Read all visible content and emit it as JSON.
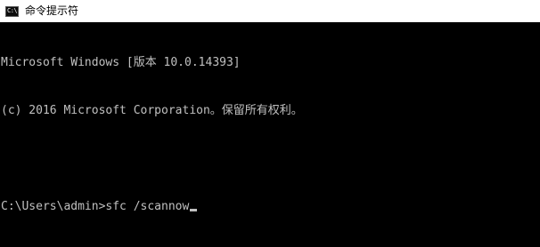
{
  "window": {
    "title": "命令提示符",
    "icon": "cmd-icon",
    "icon_glyph": "C:\\"
  },
  "console": {
    "lines": [
      "Microsoft Windows [版本 10.0.14393]",
      "(c) 2016 Microsoft Corporation。保留所有权利。",
      "",
      "C:\\Users\\admin>sfc /scannow"
    ],
    "cursor": "underline-cursor"
  },
  "colors": {
    "background": "#000000",
    "text": "#c0c0c0",
    "titlebar": "#ffffff"
  }
}
